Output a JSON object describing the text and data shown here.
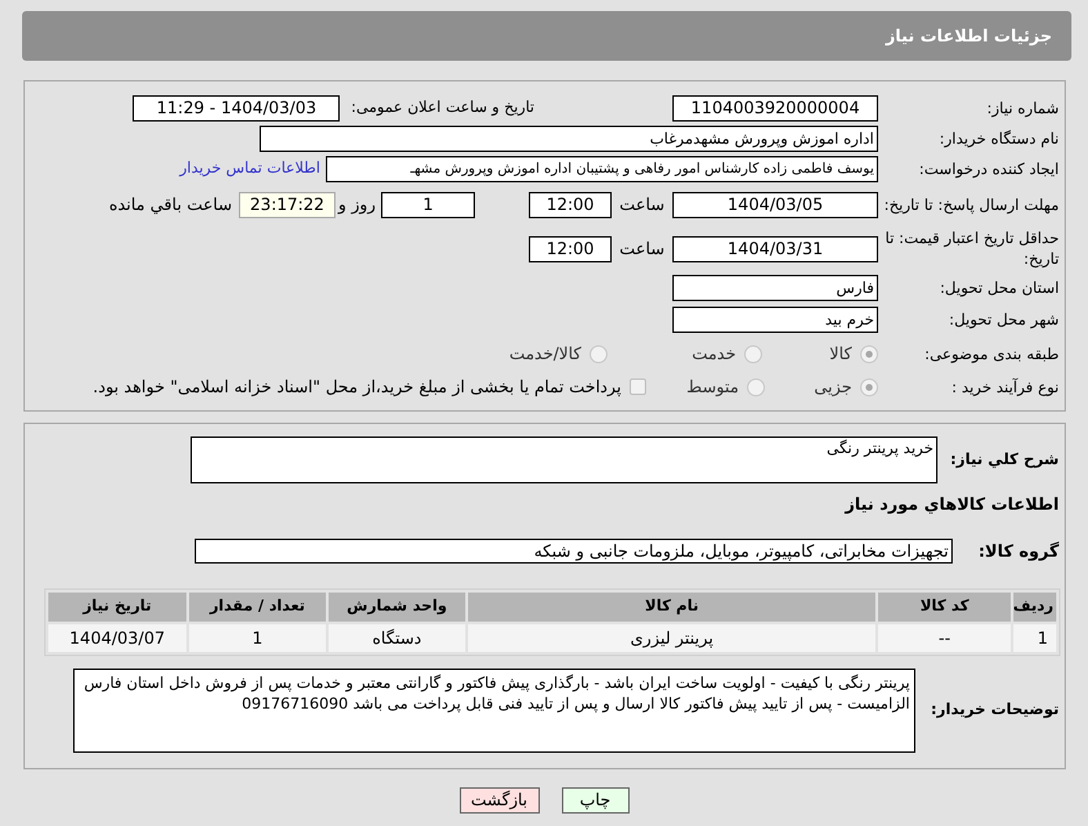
{
  "header": {
    "title": "جزئیات اطلاعات نیاز"
  },
  "details": {
    "need_number": {
      "label": "شماره نیاز:",
      "value": "1104003920000004"
    },
    "announce": {
      "label": "تاریخ و ساعت اعلان عمومی:",
      "value": "1404/03/03 - 11:29"
    },
    "buyer_org": {
      "label": "نام دستگاه خریدار:",
      "value": "اداره اموزش وپرورش مشهدمرغاب"
    },
    "creator": {
      "label": "ایجاد کننده درخواست:",
      "value": "یوسف فاطمی زاده کارشناس امور رفاهی و پشتیبان  اداره اموزش وپرورش مشهـ",
      "link": "اطلاعات تماس خریدار"
    },
    "reply_deadline": {
      "label": "مهلت ارسال پاسخ: تا تاریخ:",
      "date": "1404/03/05",
      "time_label": "ساعت",
      "time": "12:00",
      "days": "1",
      "days_label": "روز و",
      "remaining": "23:17:22",
      "remaining_label": "ساعت باقي مانده"
    },
    "price_validity": {
      "label": "حداقل تاریخ اعتبار قیمت: تا تاریخ:",
      "date": "1404/03/31",
      "time_label": "ساعت",
      "time": "12:00"
    },
    "province": {
      "label": "استان محل تحویل:",
      "value": "فارس"
    },
    "city": {
      "label": "شهر محل تحویل:",
      "value": "خرم بید"
    },
    "category": {
      "label": "طبقه بندی موضوعی:",
      "options": [
        {
          "label": "کالا",
          "selected": true
        },
        {
          "label": "خدمت",
          "selected": false
        },
        {
          "label": "کالا/خدمت",
          "selected": false
        }
      ]
    },
    "process": {
      "label": "نوع فرآیند خرید :",
      "options": [
        {
          "label": "جزیی",
          "selected": true
        },
        {
          "label": "متوسط",
          "selected": false
        }
      ],
      "treasury": {
        "checked": false,
        "label": "پرداخت تمام یا بخشی از مبلغ خرید،از محل \"اسناد خزانه اسلامی\" خواهد بود."
      }
    }
  },
  "needs": {
    "summary": {
      "label": "شرح کلي نیاز:",
      "value": "خرید پرینتر رنگی"
    },
    "goods_heading": "اطلاعات کالاهاي مورد نیاز",
    "group": {
      "label": "گروه کالا:",
      "value": "تجهیزات مخابراتی، کامپیوتر، موبایل، ملزومات جانبی و شبکه"
    },
    "table": {
      "columns": [
        "ردیف",
        "کد کالا",
        "نام کالا",
        "واحد شمارش",
        "تعداد / مقدار",
        "تاریخ نیاز"
      ],
      "rows": [
        [
          "1",
          "--",
          "پرینتر لیزری",
          "دستگاه",
          "1",
          "1404/03/07"
        ]
      ]
    },
    "buyer_notes": {
      "label": "توضیحات خریدار:",
      "value": "پرینتر رنگی با کیفیت - اولویت ساخت ایران باشد - بارگذاری پیش فاکتور و گارانتی معتبر و خدمات پس از فروش داخل استان فارس الزامیست - پس از تایید پیش فاکتور کالا ارسال و پس از تایید فنی قابل پرداخت می باشد 09176716090"
    }
  },
  "buttons": [
    {
      "label": "چاپ",
      "kind": "print"
    },
    {
      "label": "بازگشت",
      "kind": "back"
    }
  ]
}
